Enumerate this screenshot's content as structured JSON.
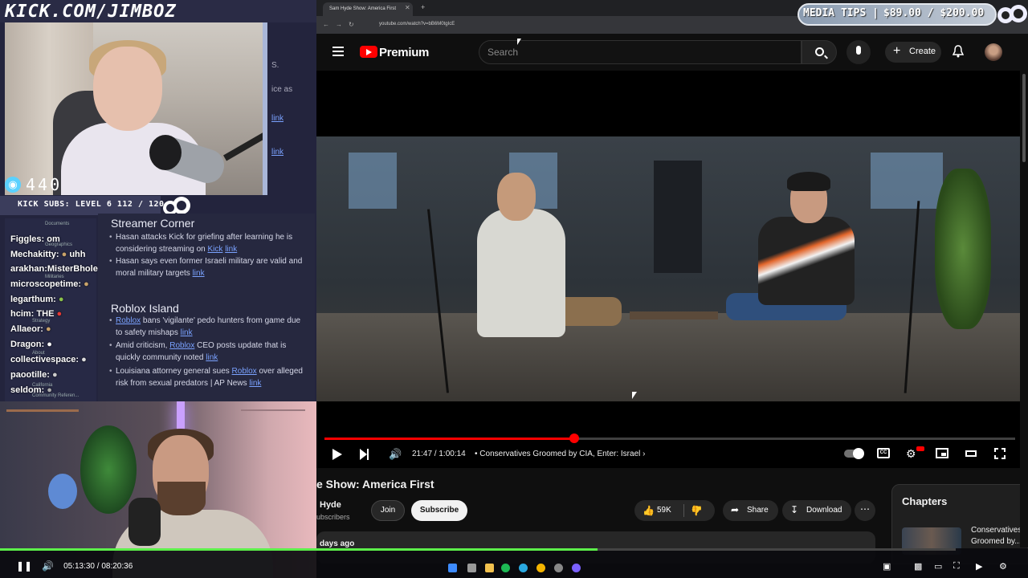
{
  "stream_overlay": {
    "channel_url": "KICK.COM/JIMBOZ",
    "viewer_count": "440",
    "kick_subs": "KICK SUBS: LEVEL 6 112 / 120",
    "behind_text": [
      "S.",
      "ice as",
      "link",
      "link"
    ],
    "chat": [
      {
        "user": "Figgles:",
        "msg": "om"
      },
      {
        "user": "Mechakitty:",
        "msg": "uhh"
      },
      {
        "user": "arakhan:",
        "msg": "MisterBhole"
      },
      {
        "user": "microscopetime:",
        "msg": ""
      },
      {
        "user": "legarthum:",
        "msg": ""
      },
      {
        "user": "hcim:",
        "msg": "THE"
      },
      {
        "user": "Allaeor:",
        "msg": ""
      },
      {
        "user": "Dragon:",
        "msg": ""
      },
      {
        "user": "collectivespace:",
        "msg": ""
      },
      {
        "user": "paootille:",
        "msg": ""
      },
      {
        "user": "seldom:",
        "msg": ""
      }
    ],
    "ghost_labels": [
      "Documents",
      "Geographics",
      "Militaries",
      "Strategy",
      "About",
      "California",
      "Community Referen..."
    ],
    "news": {
      "section1": "Streamer Corner",
      "s1_items": [
        {
          "pre": "Hasan attacks Kick for griefing after learning he is considering streaming on ",
          "link": "Kick",
          "post": " ",
          "tail": "link"
        },
        {
          "pre": "Hasan says even former Israeli military are valid and moral military targets ",
          "link": "",
          "post": "",
          "tail": "link"
        }
      ],
      "section2": "Roblox Island",
      "s2_items": [
        {
          "pre": "",
          "link": "Roblox",
          "post": " bans 'vigilante' pedo hunters from game due to safety mishaps ",
          "tail": "link"
        },
        {
          "pre": "Amid criticism, ",
          "link": "Roblox",
          "post": " CEO posts update that is quickly community noted ",
          "tail": "link"
        },
        {
          "pre": "Louisiana attorney general sues ",
          "link": "Roblox",
          "post": " over alleged risk from sexual predators | AP News ",
          "tail": "link"
        }
      ]
    },
    "vod_time": "05:13:30 / 08:20:36",
    "vod_progress": 0.625
  },
  "browser": {
    "tab_title": "Sam Hyde Show: America First",
    "url": "youtube.com/watch?v=bB6M0tgIcE"
  },
  "youtube": {
    "brand": "Premium",
    "search_placeholder": "Search",
    "create_label": "Create",
    "player": {
      "time": "21:47 / 1:00:14",
      "chapter": "Conservatives Groomed by CIA, Enter: Israel",
      "progress": 0.3618,
      "cc_label": "CC"
    },
    "video_title": "e Show: America First",
    "channel_name": "Hyde",
    "subscribers": "ubscribers",
    "join_label": "Join",
    "subscribe_label": "Subscribe",
    "likes": "59K",
    "share_label": "Share",
    "download_label": "Download",
    "upload_date": "days ago",
    "chapters_title": "Chapters",
    "chapter_item": "Conservatives Groomed by..."
  },
  "media_tips": {
    "label": "MEDIA TIPS |",
    "amount": "$89.00 / $200.00"
  },
  "colors": {
    "yt_red": "#ff0000",
    "vod_green": "#5cf04a",
    "overlay_bg": "#23243d"
  }
}
